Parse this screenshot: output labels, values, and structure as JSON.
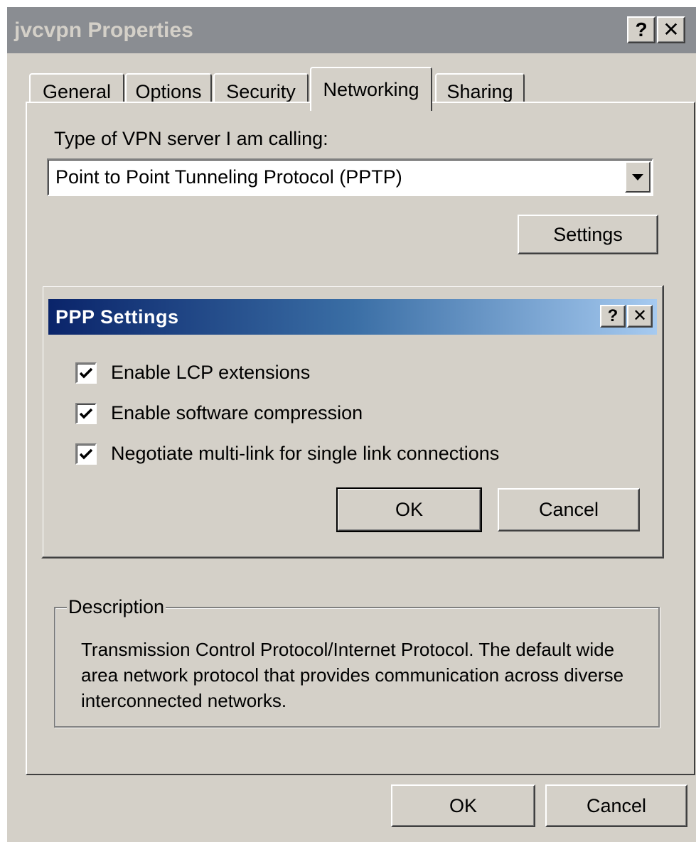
{
  "window": {
    "title": "jvcvpn Properties",
    "help_button": "?",
    "close_button": "✕"
  },
  "tabs": [
    {
      "label": "General",
      "active": false
    },
    {
      "label": "Options",
      "active": false
    },
    {
      "label": "Security",
      "active": false
    },
    {
      "label": "Networking",
      "active": true
    },
    {
      "label": "Sharing",
      "active": false
    }
  ],
  "networking": {
    "vpn_type_label": "Type of VPN server I am calling:",
    "vpn_type_value": "Point to Point Tunneling Protocol (PPTP)",
    "settings_button": "Settings"
  },
  "ppp_dialog": {
    "title": "PPP Settings",
    "help_button": "?",
    "close_button": "✕",
    "options": [
      {
        "label": "Enable LCP extensions",
        "checked": true
      },
      {
        "label": "Enable software compression",
        "checked": true
      },
      {
        "label": "Negotiate multi-link for single link connections",
        "checked": true
      }
    ],
    "ok_button": "OK",
    "cancel_button": "Cancel"
  },
  "description": {
    "legend": "Description",
    "text": "Transmission Control Protocol/Internet Protocol. The default wide area network protocol that provides communication across diverse interconnected networks."
  },
  "footer": {
    "ok_button": "OK",
    "cancel_button": "Cancel"
  },
  "colors": {
    "face": "#d4d0c8",
    "inactive_titlebar": "#8a8d92",
    "active_titlebar_start": "#0a246a",
    "active_titlebar_end": "#a6caf0"
  }
}
